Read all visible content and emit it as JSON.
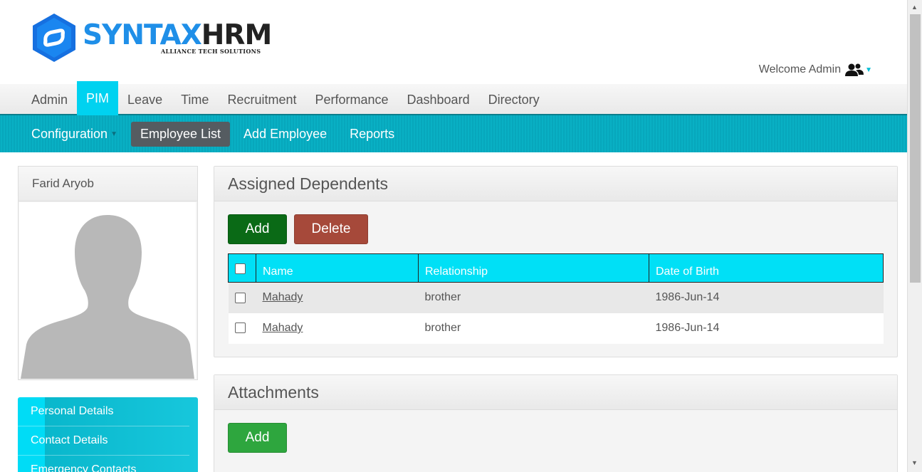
{
  "header": {
    "logo_main_blue": "SYNTAX",
    "logo_main_dark": "HRM",
    "logo_sub": "ALLIANCE TECH SOLUTIONS",
    "welcome_text": "Welcome Admin",
    "user_icon": "users-icon"
  },
  "colors": {
    "accent": "#00d2f0",
    "submenu_bg": "#06a3b8",
    "add_button": "#0a6a16",
    "delete_button": "#a6493a",
    "add_attachment_button": "#2ea63e"
  },
  "main_menu": {
    "items": [
      {
        "label": "Admin"
      },
      {
        "label": "PIM"
      },
      {
        "label": "Leave"
      },
      {
        "label": "Time"
      },
      {
        "label": "Recruitment"
      },
      {
        "label": "Performance"
      },
      {
        "label": "Dashboard"
      },
      {
        "label": "Directory"
      }
    ],
    "active": "PIM"
  },
  "sub_menu": {
    "items": [
      {
        "label": "Configuration"
      },
      {
        "label": "Employee List"
      },
      {
        "label": "Add Employee"
      },
      {
        "label": "Reports"
      }
    ],
    "active": "Employee List"
  },
  "profile": {
    "name": "Farid Aryob"
  },
  "side_nav": {
    "items": [
      {
        "label": "Personal Details"
      },
      {
        "label": "Contact Details"
      },
      {
        "label": "Emergency Contacts"
      }
    ]
  },
  "dependents": {
    "title": "Assigned Dependents",
    "add_label": "Add",
    "delete_label": "Delete",
    "columns": [
      "Name",
      "Relationship",
      "Date of Birth"
    ],
    "rows": [
      {
        "name": "Mahady",
        "relationship": "brother",
        "dob": "1986-Jun-14"
      },
      {
        "name": "Mahady",
        "relationship": "brother",
        "dob": "1986-Jun-14"
      }
    ]
  },
  "attachments": {
    "title": "Attachments",
    "add_label": "Add"
  }
}
